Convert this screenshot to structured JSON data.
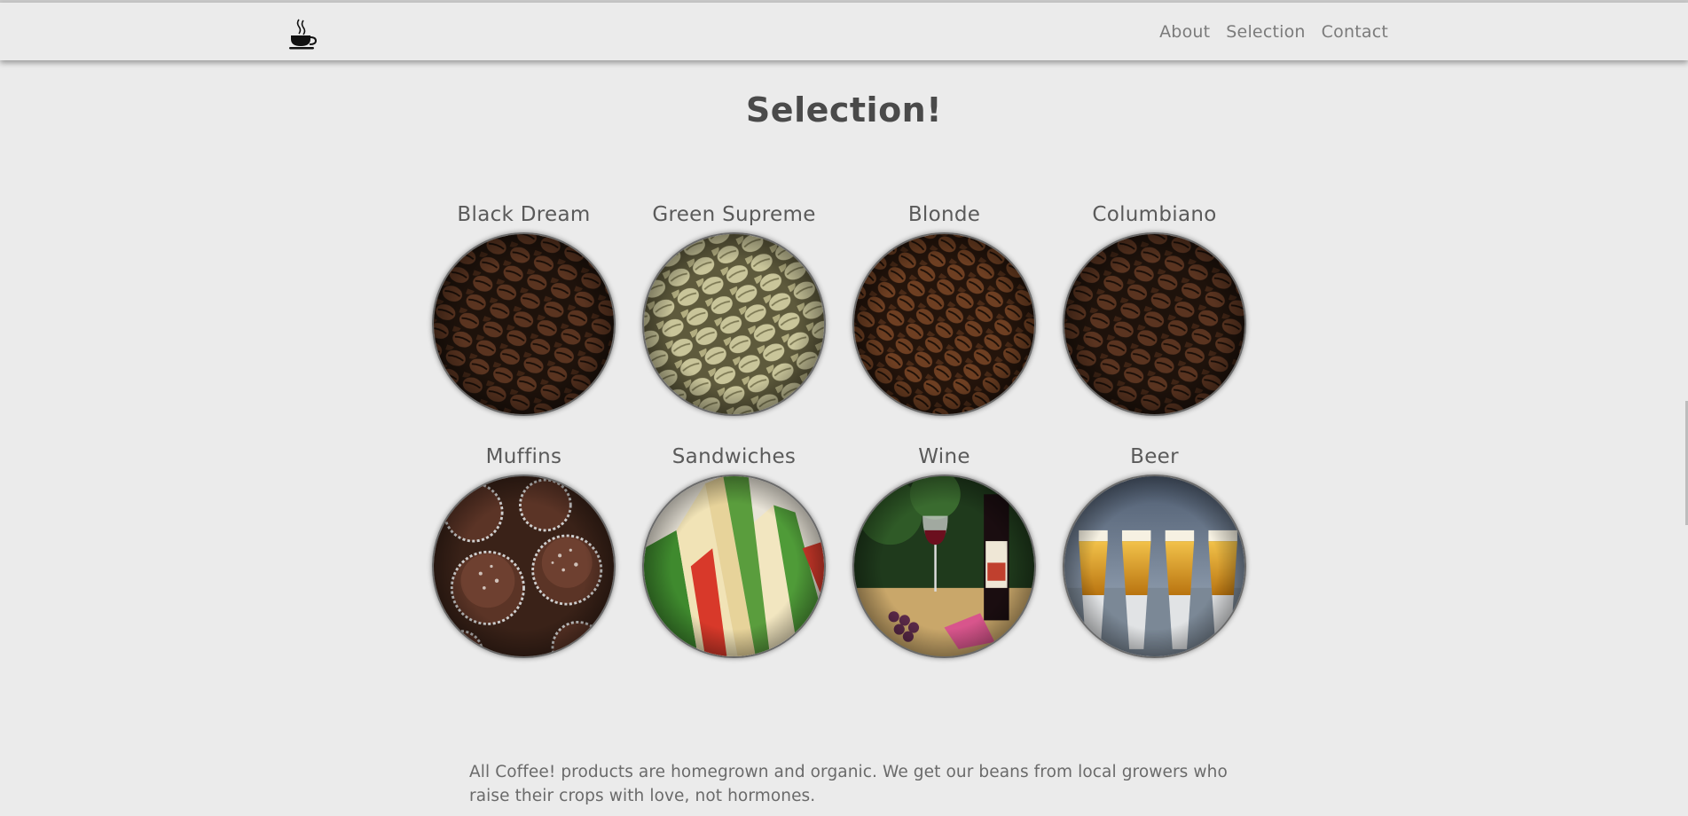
{
  "nav": {
    "logo_icon": "coffee-cup-icon",
    "links": [
      {
        "label": "About"
      },
      {
        "label": "Selection"
      },
      {
        "label": "Contact"
      }
    ]
  },
  "page": {
    "title": "Selection!"
  },
  "products": [
    {
      "name": "Black Dream",
      "image": "dark-coffee-beans"
    },
    {
      "name": "Green Supreme",
      "image": "green-coffee-beans"
    },
    {
      "name": "Blonde",
      "image": "medium-coffee-beans"
    },
    {
      "name": "Columbiano",
      "image": "dark-coffee-beans"
    },
    {
      "name": "Muffins",
      "image": "chocolate-muffins"
    },
    {
      "name": "Sandwiches",
      "image": "sandwiches"
    },
    {
      "name": "Wine",
      "image": "wine-bottle-glass"
    },
    {
      "name": "Beer",
      "image": "beer-glasses"
    }
  ],
  "footer": {
    "text": "All Coffee! products are homegrown and organic. We get our beans from local growers who raise their crops with love, not hormones."
  }
}
